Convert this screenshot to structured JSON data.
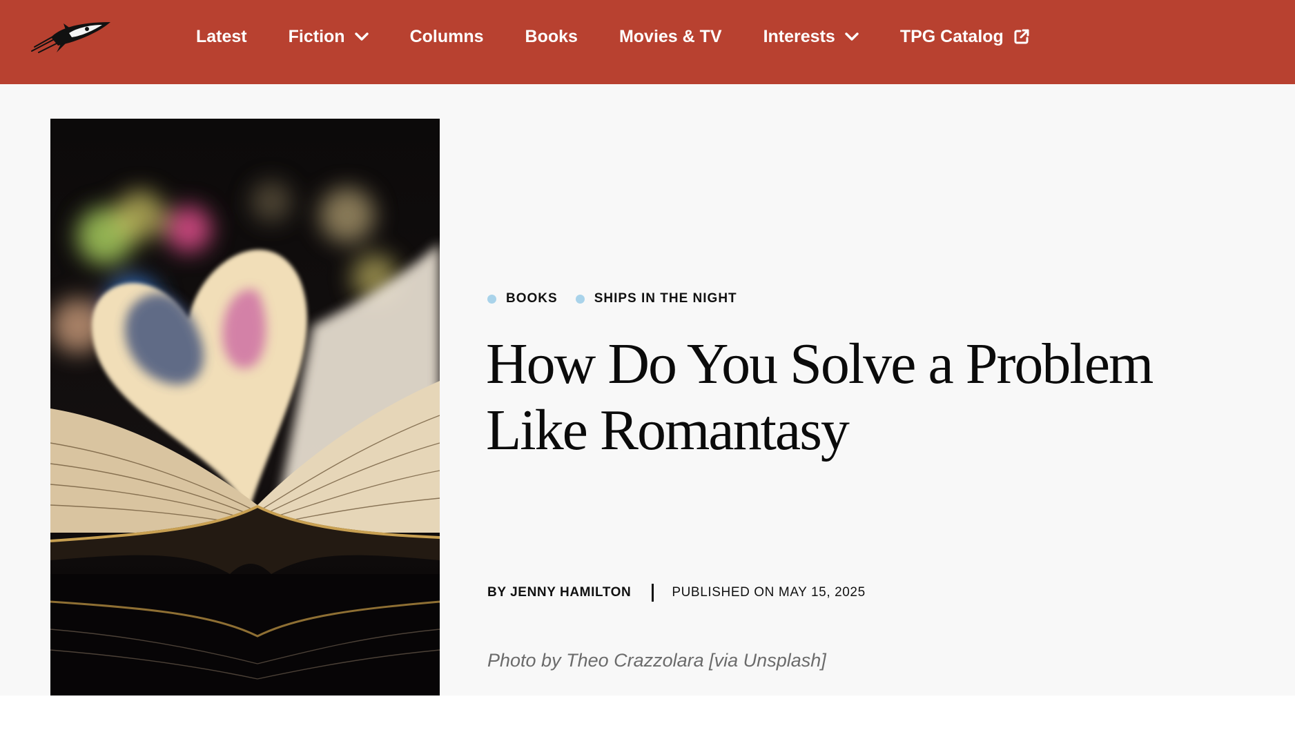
{
  "header": {
    "logo_icon": "rocket-ship-logo-icon",
    "nav": [
      {
        "label": "Latest",
        "has_dropdown": false,
        "external": false
      },
      {
        "label": "Fiction",
        "has_dropdown": true,
        "external": false
      },
      {
        "label": "Columns",
        "has_dropdown": false,
        "external": false
      },
      {
        "label": "Books",
        "has_dropdown": false,
        "external": false
      },
      {
        "label": "Movies & TV",
        "has_dropdown": false,
        "external": false
      },
      {
        "label": "Interests",
        "has_dropdown": true,
        "external": false
      },
      {
        "label": "TPG Catalog",
        "has_dropdown": false,
        "external": true
      }
    ],
    "icons": {
      "dropdown": "chevron-down-icon",
      "external": "external-link-icon"
    }
  },
  "article": {
    "tags": [
      "BOOKS",
      "SHIPS IN THE NIGHT"
    ],
    "title": "How Do You Solve a Problem Like Romantasy",
    "author": "BY JENNY HAMILTON",
    "published": "PUBLISHED ON MAY 15, 2025",
    "caption": "Photo by Theo Crazzolara [via Unsplash]",
    "image_subject": "open book with pages folded into a heart shape"
  },
  "colors": {
    "header_bg": "#b84130",
    "page_bg": "#f8f8f8",
    "tag_dot": "#a9d3ea",
    "text": "#0b0b0b",
    "caption": "#6b6b6b"
  }
}
